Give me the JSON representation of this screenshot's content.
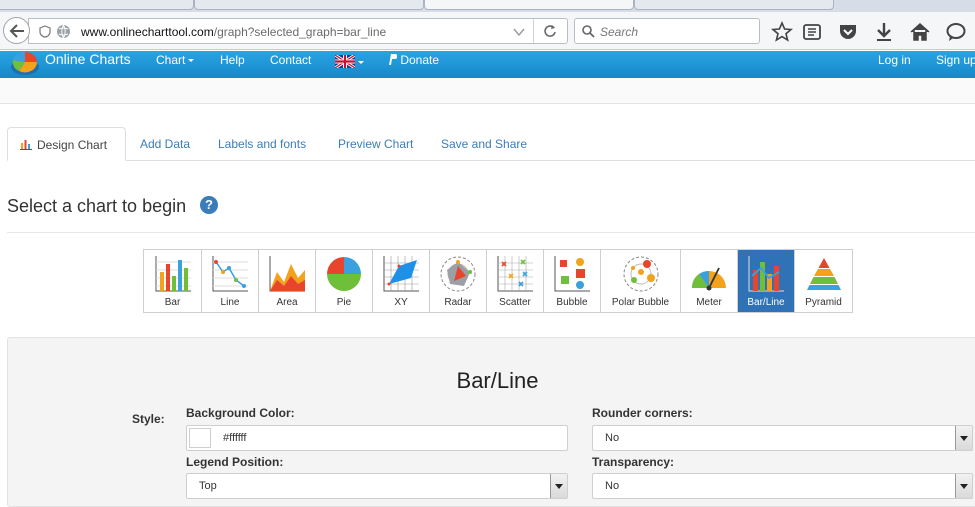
{
  "browser": {
    "url_host": "www.onlinecharttool.com",
    "url_path": "/graph?selected_graph=bar_line",
    "search_placeholder": "Search"
  },
  "navbar": {
    "brand": "Online Charts",
    "items": [
      "Chart",
      "Help",
      "Contact",
      "Donate"
    ],
    "login": "Log in",
    "signup": "Sign up"
  },
  "tabs": [
    "Design Chart",
    "Add Data",
    "Labels and fonts",
    "Preview Chart",
    "Save and Share"
  ],
  "page_title": "Select a chart to begin",
  "help_glyph": "?",
  "chart_types": [
    {
      "label": "Bar",
      "icon": "bar-chart-icon"
    },
    {
      "label": "Line",
      "icon": "line-chart-icon"
    },
    {
      "label": "Area",
      "icon": "area-chart-icon"
    },
    {
      "label": "Pie",
      "icon": "pie-chart-icon"
    },
    {
      "label": "XY",
      "icon": "xy-chart-icon"
    },
    {
      "label": "Radar",
      "icon": "radar-chart-icon"
    },
    {
      "label": "Scatter",
      "icon": "scatter-chart-icon"
    },
    {
      "label": "Bubble",
      "icon": "bubble-chart-icon"
    },
    {
      "label": "Polar Bubble",
      "icon": "polar-bubble-chart-icon"
    },
    {
      "label": "Meter",
      "icon": "meter-chart-icon"
    },
    {
      "label": "Bar/Line",
      "icon": "bar-line-chart-icon",
      "selected": true
    },
    {
      "label": "Pyramid",
      "icon": "pyramid-chart-icon"
    }
  ],
  "settings": {
    "title": "Bar/Line",
    "style_label": "Style:",
    "background_color_label": "Background Color:",
    "background_color_value": "#ffffff",
    "rounder_corners_label": "Rounder corners:",
    "rounder_corners_value": "No",
    "legend_position_label": "Legend Position:",
    "legend_position_value": "Top",
    "transparency_label": "Transparency:",
    "transparency_value": "No"
  },
  "colors": {
    "navbar": "#1a93d4",
    "link": "#3b7dbb",
    "selected_tile": "#2f72b5"
  }
}
